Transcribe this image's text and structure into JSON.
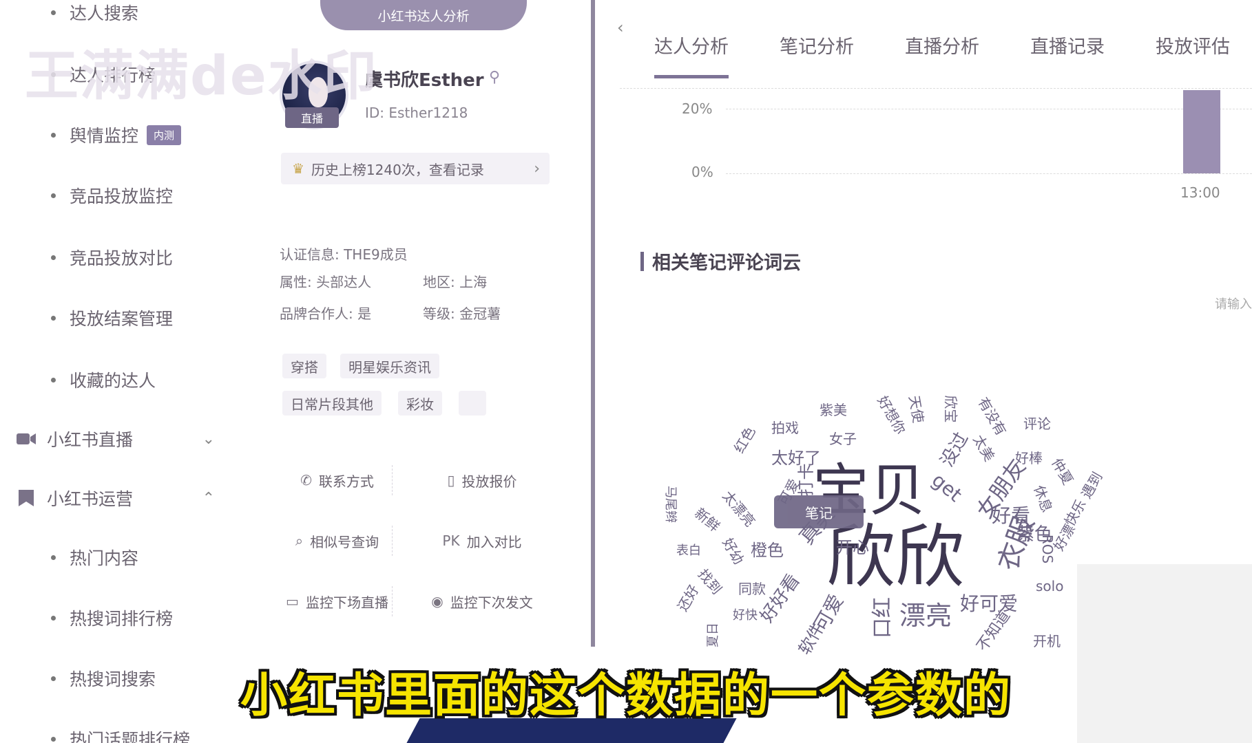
{
  "watermark": "王满满de水印",
  "sidebar": {
    "items": [
      {
        "label": "达人搜索"
      },
      {
        "label": "达人排行榜"
      },
      {
        "label": "舆情监控",
        "badge": "内测"
      },
      {
        "label": "竞品投放监控"
      },
      {
        "label": "竞品投放对比"
      },
      {
        "label": "投放结案管理"
      },
      {
        "label": "收藏的达人"
      }
    ],
    "groups": [
      {
        "label": "小红书直播",
        "chevron": "⌄"
      },
      {
        "label": "小红书运营",
        "chevron": "⌃"
      }
    ],
    "sub_items": [
      {
        "label": "热门内容"
      },
      {
        "label": "热搜词排行榜"
      },
      {
        "label": "热搜词搜索"
      },
      {
        "label": "热门话题排行榜"
      }
    ]
  },
  "profile": {
    "top_tab": "小红书达人分析",
    "name": "虞书欣Esther",
    "id_text": "ID: Esther1218",
    "live_tag": "直播",
    "history": "历史上榜1240次，查看记录",
    "cert": "认证信息: THE9成员",
    "attr": "属性: 头部达人",
    "region": "地区: 上海",
    "partner": "品牌合作人: 是",
    "level": "等级: 金冠薯",
    "tags": [
      "穿搭",
      "明星娱乐资讯",
      "日常片段其他",
      "彩妆"
    ],
    "actions": [
      {
        "label": "联系方式",
        "icon": "phone-icon"
      },
      {
        "label": "投放报价",
        "icon": "quote-icon"
      },
      {
        "label": "相似号查询",
        "icon": "search-icon"
      },
      {
        "label": "加入对比",
        "icon": "pk-icon"
      },
      {
        "label": "监控下场直播",
        "icon": "camera-icon"
      },
      {
        "label": "监控下次发文",
        "icon": "bell-icon"
      }
    ]
  },
  "analysis": {
    "tabs": [
      "达人分析",
      "笔记分析",
      "直播分析",
      "直播记录",
      "投放评估"
    ],
    "active_tab": 0,
    "section_title": "相关笔记评论词云",
    "search_hint": "请输入"
  },
  "chart_data": {
    "type": "bar",
    "y_ticks": [
      "20%",
      "0%"
    ],
    "categories": [
      "13:00"
    ],
    "values": [
      25
    ],
    "ylim": [
      0,
      25
    ]
  },
  "wordcloud": {
    "chip": "笔记",
    "words": [
      "宝贝",
      "欣欣",
      "漂亮",
      "好可爱",
      "衣服",
      "女朋友",
      "好看",
      "紫色",
      "没过",
      "get",
      "太好了",
      "女子",
      "拍戏",
      "紫美",
      "好想你",
      "天使",
      "欣宝",
      "有没有",
      "评论",
      "好棒",
      "太美",
      "仲夏",
      "遇到",
      "快乐",
      "好漂",
      "休息",
      "ROS",
      "solo",
      "同款",
      "可爱",
      "软件",
      "好好看",
      "橙色",
      "找到",
      "还好",
      "好快",
      "表白",
      "新鲜",
      "太漂亮",
      "好幼",
      "马尾辫",
      "可爱",
      "口红",
      "开心",
      "打卡",
      "红色",
      "真美",
      "不知道",
      "开机",
      "夏日"
    ]
  },
  "subtitle": "小红书里面的这个数据的一个参数的",
  "colors": {
    "accent": "#9a90ae",
    "bar": "#9b8fb2",
    "subtitle": "#f6e400"
  }
}
